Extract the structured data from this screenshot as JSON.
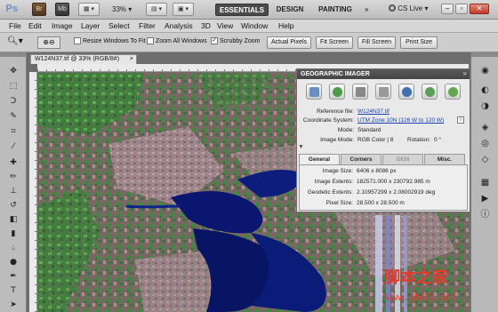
{
  "app": {
    "logo_text": "Ps",
    "bridge_label": "Br",
    "minibridge_label": "Mb",
    "zoom_level": "33%",
    "workspaces": [
      "ESSENTIALS",
      "DESIGN",
      "PAINTING"
    ],
    "cs_live": "CS Live",
    "window_controls": [
      "–",
      "▫",
      "✕"
    ]
  },
  "menu": [
    "File",
    "Edit",
    "Image",
    "Layer",
    "Select",
    "Filter",
    "Analysis",
    "3D",
    "View",
    "Window",
    "Help"
  ],
  "options": {
    "resize_windows": "Resize Windows To Fit",
    "zoom_all": "Zoom All Windows",
    "scrubby_zoom": "Scrubby Zoom",
    "actual_pixels": "Actual Pixels",
    "fit_screen": "Fit Screen",
    "fill_screen": "Fill Screen",
    "print_size": "Print Size"
  },
  "document": {
    "tab_title": "W124N37.tif @ 33% (RGB/8#)",
    "tab_close": "×"
  },
  "geo": {
    "title": "GEOGRAPHIC IMAGER",
    "close": "»",
    "reference_label": "Reference file:",
    "reference_value": "W124N37.tif",
    "coord_label": "Coordinate System:",
    "coord_value": "UTM Zone 10N (126 W to 120 W)",
    "mode_label": "Mode:",
    "mode_value": "Standard",
    "image_mode_label": "Image Mode:",
    "image_mode_value": "RGB Color",
    "bits_value": "8",
    "rotation_label": "Rotation:",
    "rotation_value": "0 °",
    "tabs": [
      "General",
      "Corners",
      "DEM",
      "Misc."
    ],
    "image_size_label": "Image Size:",
    "image_size_value": "6406 x 8086 px",
    "extents_label": "Image Extents:",
    "extents_value": "182571.000 x 230792.985 m",
    "geodetic_label": "Geodetic Extents:",
    "geodetic_value": "2.10957299 x 2.08002919 deg",
    "pixel_label": "Pixel Size:",
    "pixel_value": "28.500 x 28.500 m"
  },
  "watermark": {
    "title": "脚本之家",
    "url": "www.jb51.net"
  }
}
